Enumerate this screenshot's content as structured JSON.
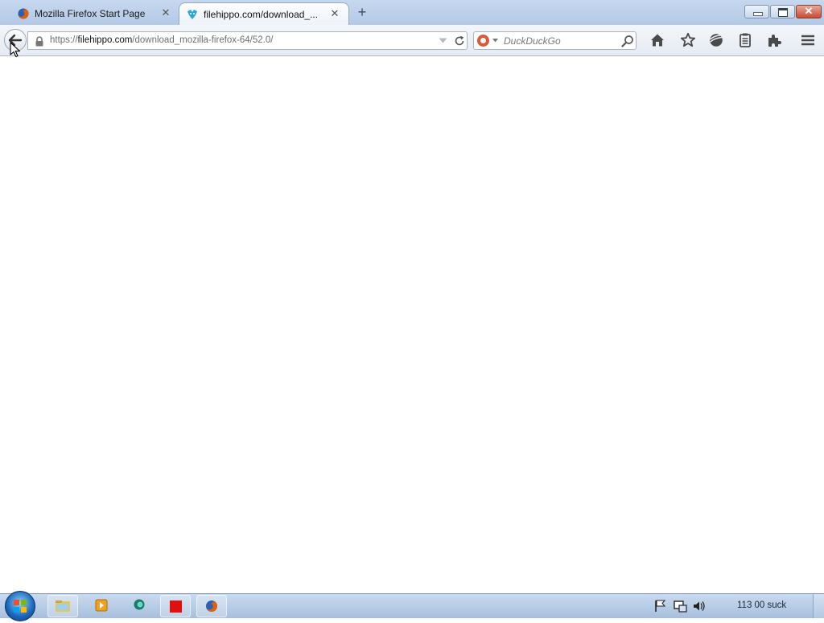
{
  "browser": {
    "tabs": [
      {
        "title": "Mozilla Firefox Start Page",
        "favicon": "firefox-icon",
        "active": false
      },
      {
        "title": "filehippo.com/download_...",
        "favicon": "filehippo-icon",
        "active": true
      }
    ],
    "new_tab_label": "+",
    "close_tab_glyph": "✕",
    "window_close_glyph": "✕",
    "url": {
      "prefix": "https://",
      "host": "filehippo.com",
      "path": "/download_mozilla-firefox-64/52.0/"
    },
    "search": {
      "engine": "DuckDuckGo",
      "placeholder": "DuckDuckGo"
    },
    "toolbar_icons": [
      "home-icon",
      "bookmark-star-icon",
      "sync-icon",
      "reader-icon",
      "addons-icon",
      "menu-icon"
    ]
  },
  "taskbar": {
    "items": [
      "explorer-icon",
      "media-player-icon",
      "app-icon",
      "red-app-icon",
      "firefox-icon"
    ],
    "clock": "113 00 suck"
  },
  "colors": {
    "accent": "#1a64b8",
    "ddg": "#de5833",
    "close_red": "#c94a33"
  }
}
